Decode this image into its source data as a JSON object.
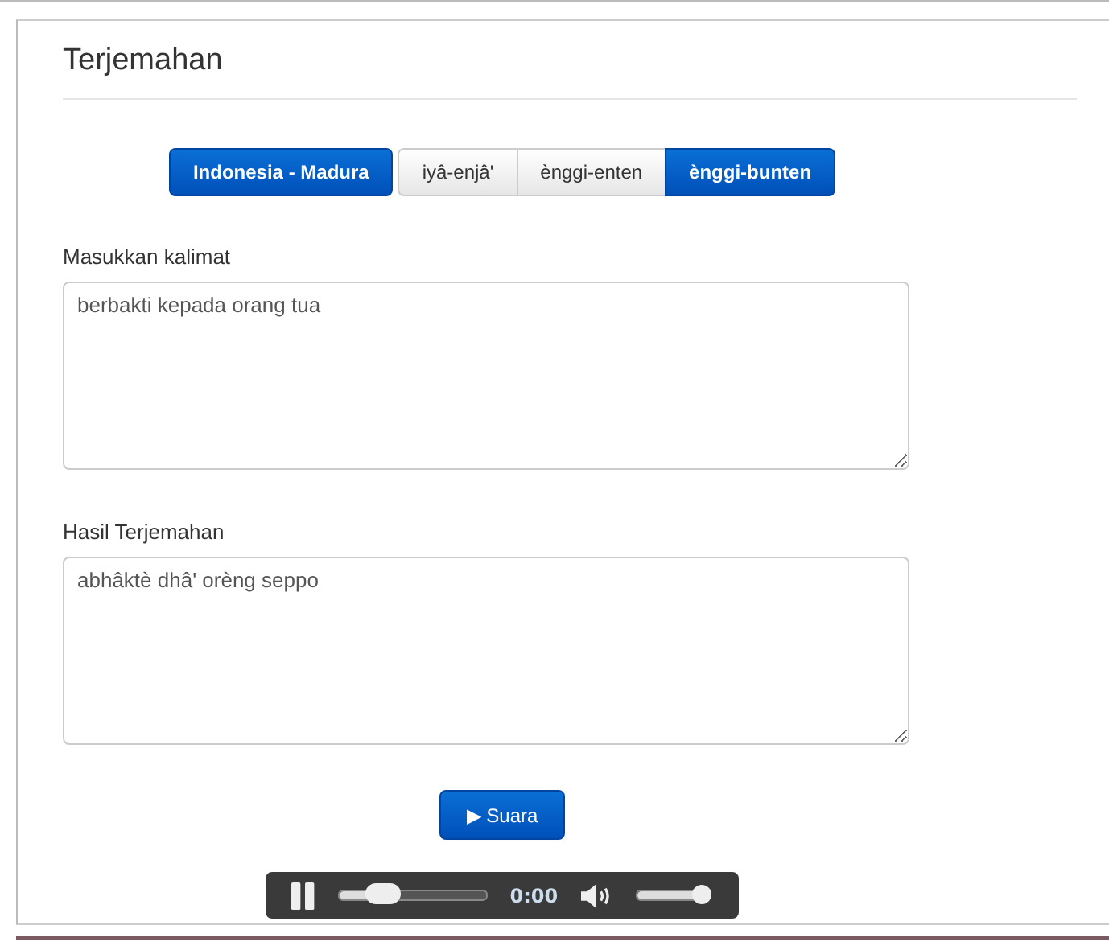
{
  "title": "Terjemahan",
  "direction": {
    "label": "Indonesia - Madura",
    "selected": true
  },
  "levels": [
    {
      "label": "iyâ-enjâ'",
      "selected": false
    },
    {
      "label": "ènggi-enten",
      "selected": false
    },
    {
      "label": "ènggi-bunten",
      "selected": true
    }
  ],
  "input": {
    "label": "Masukkan kalimat",
    "value": "berbakti kepada orang tua"
  },
  "output": {
    "label": "Hasil Terjemahan",
    "value": "abhâktè dhâ' orèng seppo"
  },
  "speak_button": {
    "icon": "▶",
    "label": "Suara"
  },
  "player": {
    "playing": true,
    "progress": {
      "level": 0.3
    },
    "time": "0:00",
    "volume": {
      "level": 1
    }
  }
}
